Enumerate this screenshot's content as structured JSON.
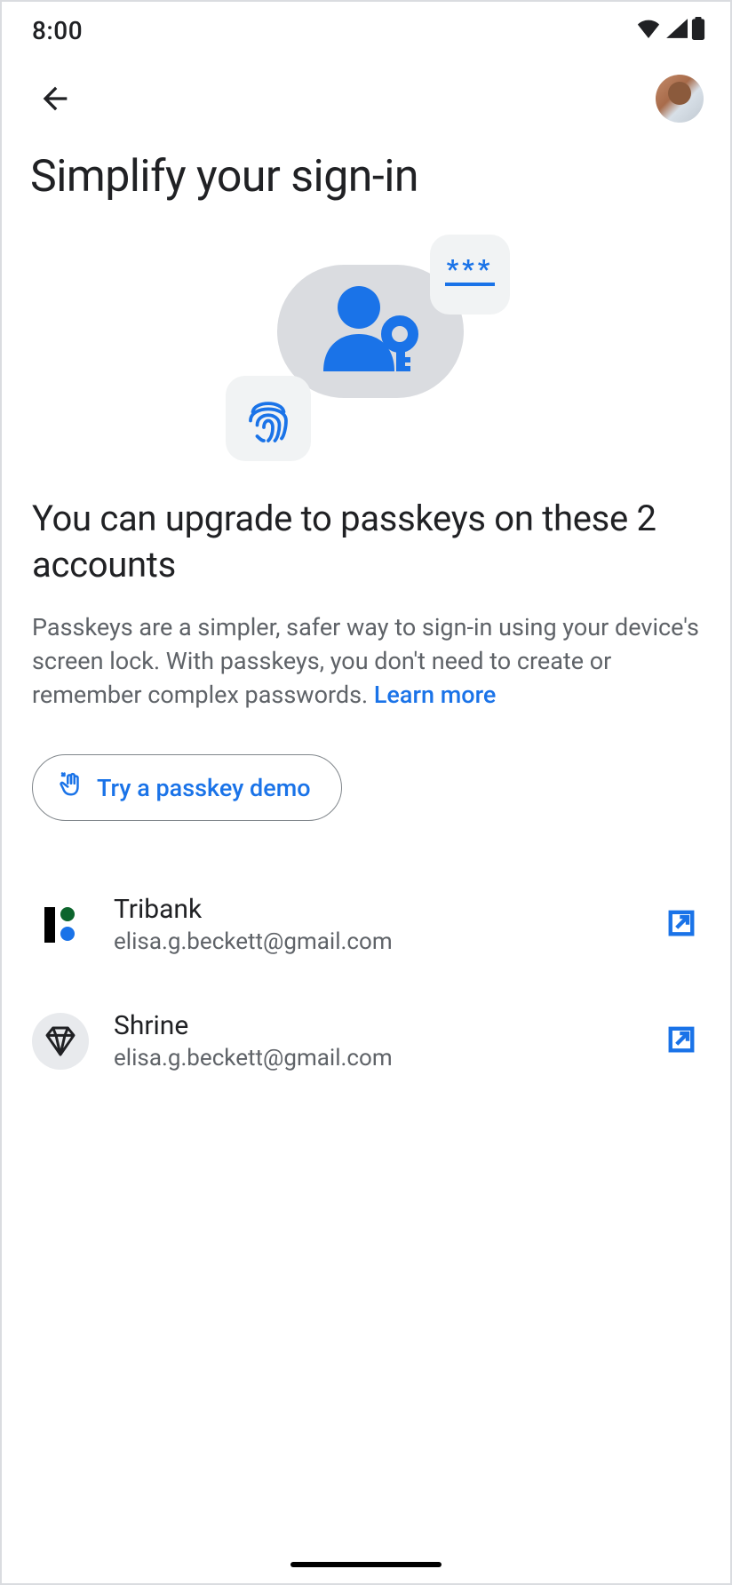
{
  "status": {
    "time": "8:00"
  },
  "header": {
    "title": "Simplify your sign-in"
  },
  "hero": {
    "password_mask": "***"
  },
  "section": {
    "subhead": "You can upgrade to passkeys on these 2 accounts",
    "body": "Passkeys are a simpler, safer way to sign-in using your device's screen lock. With passkeys, you don't need to create or remember complex passwords. ",
    "learn_more": "Learn more",
    "demo_button": "Try a passkey demo"
  },
  "accounts": [
    {
      "name": "Tribank",
      "email": "elisa.g.beckett@gmail.com",
      "icon": "tribank"
    },
    {
      "name": "Shrine",
      "email": "elisa.g.beckett@gmail.com",
      "icon": "shrine"
    }
  ],
  "colors": {
    "accent": "#1a73e8"
  }
}
